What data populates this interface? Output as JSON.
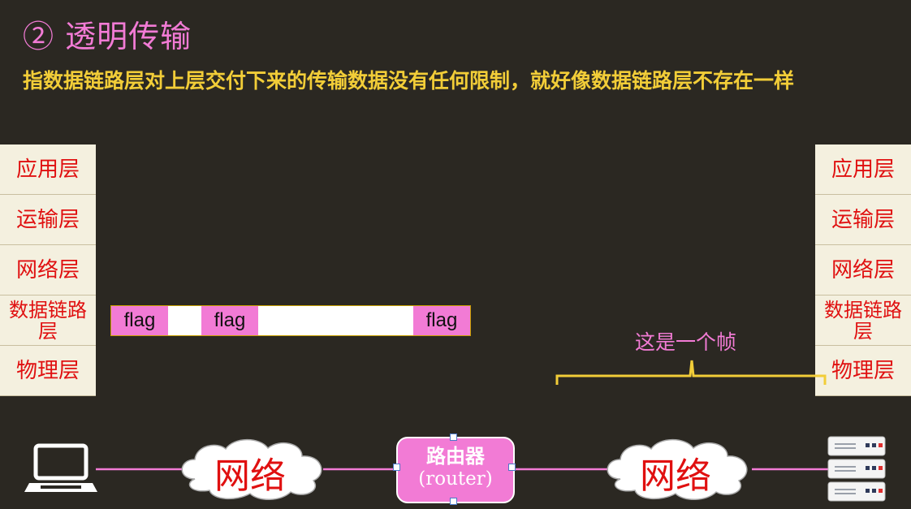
{
  "title": "② 透明传输",
  "subtitle": "指数据链路层对上层交付下来的传输数据没有任何限制，就好像数据链路层不存在一样",
  "layers": {
    "l1": "应用层",
    "l2": "运输层",
    "l3": "网络层",
    "l4": "数据链路层",
    "l5": "物理层"
  },
  "frame": {
    "flag": "flag"
  },
  "annotation": "这是一个帧",
  "network_label": "网络",
  "router": {
    "name": "路由器",
    "english": "(router)"
  },
  "colors": {
    "background": "#2b2822",
    "title": "#f27bd5",
    "subtitle": "#f2cd38",
    "layer_text": "#e01010",
    "flag_fill": "#f27bd5",
    "link_line": "#f27bd5",
    "bracket": "#f2cd38"
  }
}
